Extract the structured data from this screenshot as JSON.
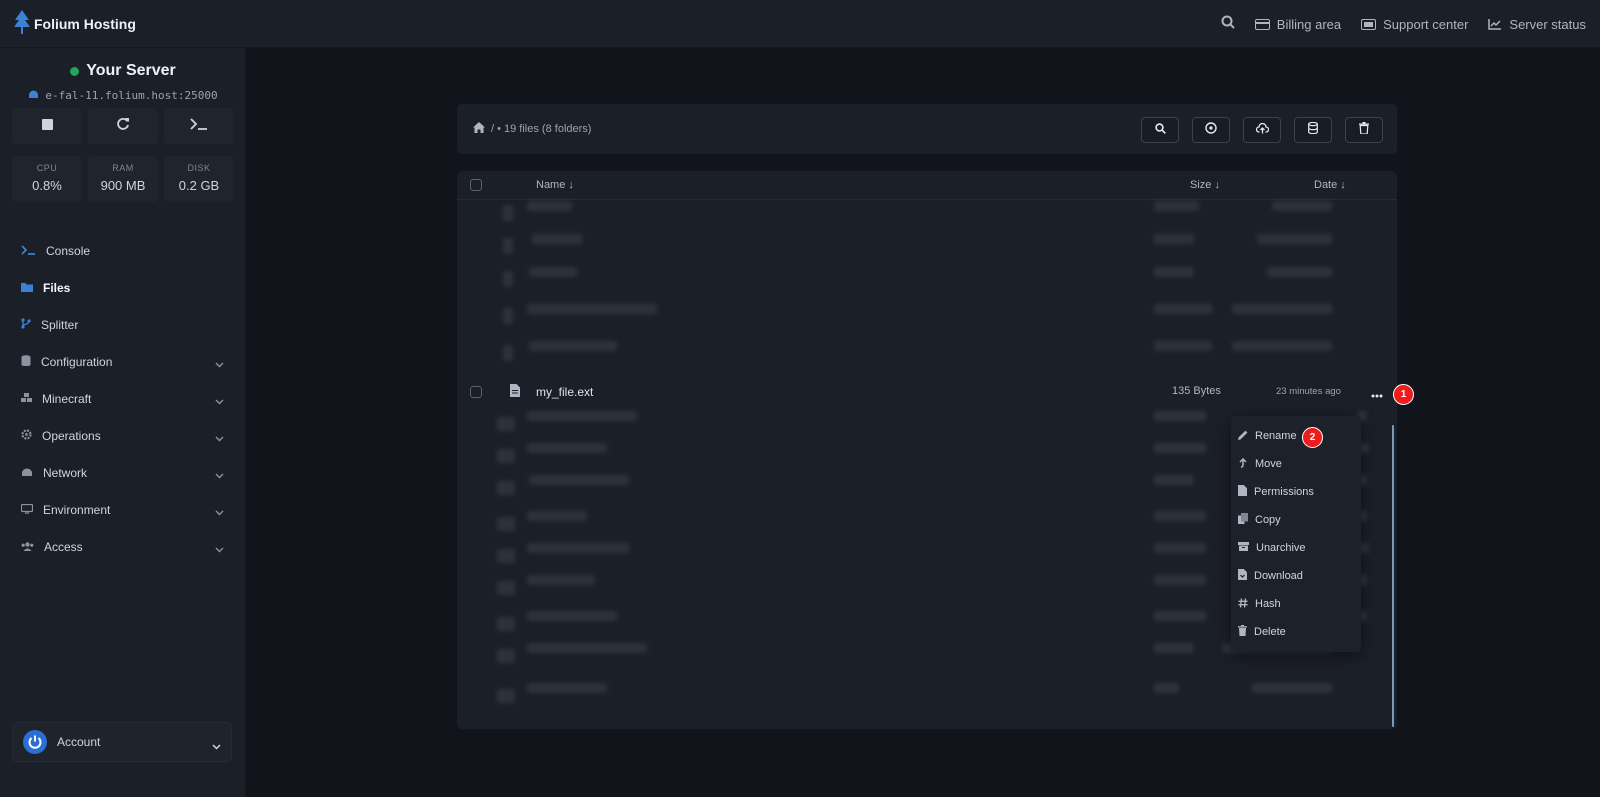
{
  "brand": {
    "name": "Folium Hosting"
  },
  "topnav": {
    "items": [
      {
        "label": "Billing area",
        "icon": "credit-card-icon"
      },
      {
        "label": "Support center",
        "icon": "ticket-icon"
      },
      {
        "label": "Server status",
        "icon": "chart-line-icon"
      }
    ],
    "search_icon": "search-icon"
  },
  "server": {
    "name": "Your Server",
    "status_color": "#22a559",
    "address": "e-fal-11.folium.host:25000"
  },
  "power": {
    "stop_icon": "stop-icon",
    "restart_icon": "restart-icon",
    "console_icon": "terminal-icon"
  },
  "stats": [
    {
      "label": "CPU",
      "value": "0.8%"
    },
    {
      "label": "RAM",
      "value": "900 MB"
    },
    {
      "label": "DISK",
      "value": "0.2 GB"
    }
  ],
  "nav": {
    "items": [
      {
        "label": "Console",
        "icon": "terminal-icon"
      },
      {
        "label": "Files",
        "icon": "folder-icon",
        "active": true
      },
      {
        "label": "Splitter",
        "icon": "branch-icon"
      },
      {
        "label": "Configuration",
        "icon": "database-icon",
        "expandable": true
      },
      {
        "label": "Minecraft",
        "icon": "cubes-icon",
        "expandable": true
      },
      {
        "label": "Operations",
        "icon": "gear-icon",
        "expandable": true
      },
      {
        "label": "Network",
        "icon": "network-icon",
        "expandable": true
      },
      {
        "label": "Environment",
        "icon": "monitor-icon",
        "expandable": true
      },
      {
        "label": "Access",
        "icon": "users-icon",
        "expandable": true
      }
    ]
  },
  "account": {
    "label": "Account"
  },
  "files": {
    "breadcrumb": "/ • 19 files (8 folders)",
    "columns": {
      "name": "Name ↓",
      "size": "Size ↓",
      "date": "Date ↓"
    },
    "highlighted_file": {
      "name": "my_file.ext",
      "size": "135 Bytes",
      "date": "23 minutes ago"
    }
  },
  "context_menu": {
    "items": [
      {
        "label": "Rename",
        "icon": "pencil-icon"
      },
      {
        "label": "Move",
        "icon": "arrow-up-icon"
      },
      {
        "label": "Permissions",
        "icon": "file-icon"
      },
      {
        "label": "Copy",
        "icon": "copy-icon"
      },
      {
        "label": "Unarchive",
        "icon": "archive-icon"
      },
      {
        "label": "Download",
        "icon": "file-download-icon"
      },
      {
        "label": "Hash",
        "icon": "hash-icon"
      },
      {
        "label": "Delete",
        "icon": "trash-icon"
      }
    ]
  },
  "callouts": {
    "first": "1",
    "second": "2"
  },
  "colors": {
    "accent": "#3b82d6",
    "badge": "#ee1c1c"
  }
}
